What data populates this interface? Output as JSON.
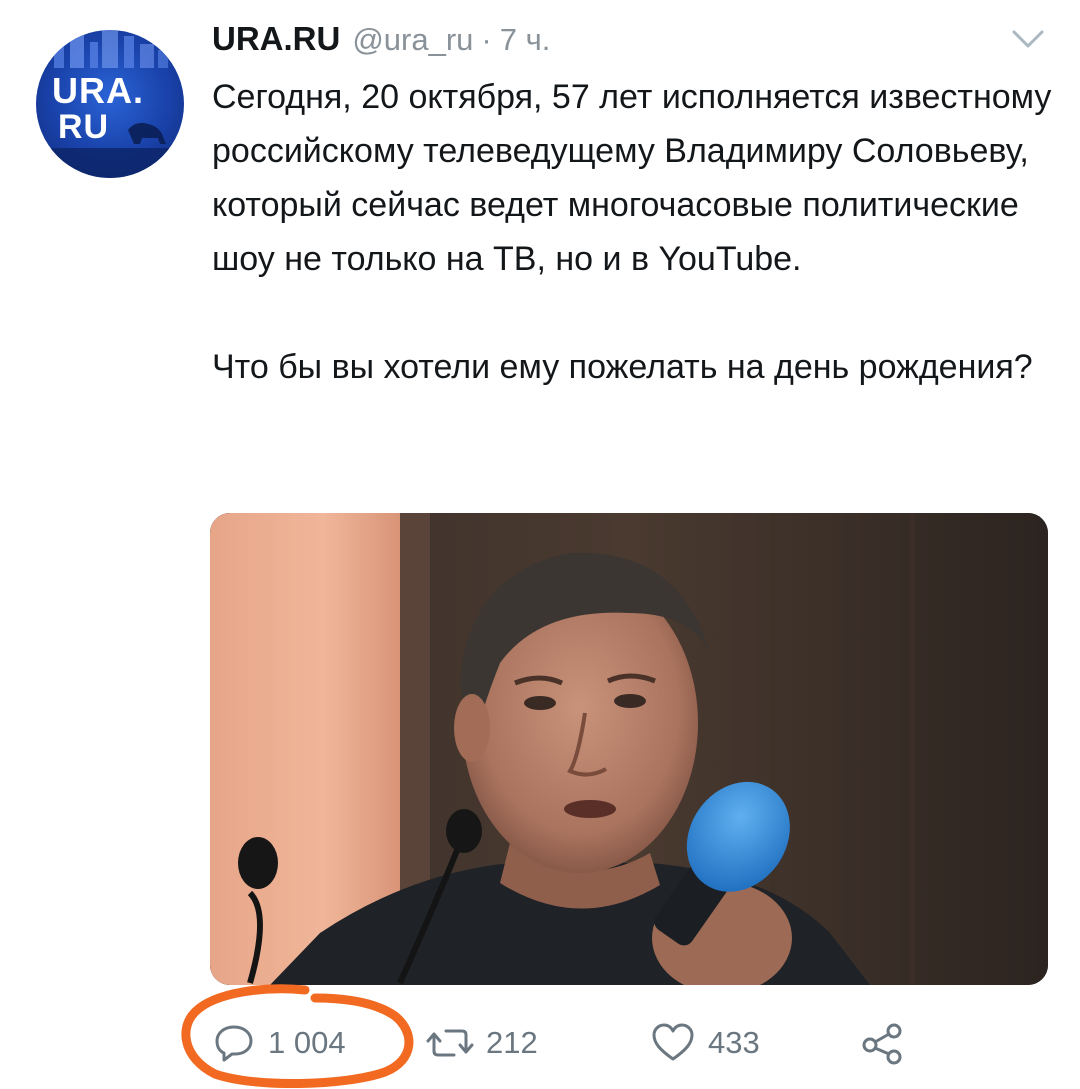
{
  "avatar": {
    "logo_line1": "URA.",
    "logo_line2": "RU",
    "icon": "ura-ru-logo"
  },
  "header": {
    "display_name": "URA.RU",
    "handle": "@ura_ru",
    "separator": "·",
    "time": "7 ч.",
    "menu_icon": "chevron-down-icon"
  },
  "tweet": {
    "paragraph1": "Сегодня, 20 октября, 57 лет исполняется известному российскому телеведущему Владимиру Соловьеву, который сейчас ведет многочасовые политические шоу не только на ТВ, но и в YouTube.",
    "paragraph2": "Что бы вы хотели ему пожелать на день рождения?"
  },
  "media": {
    "kind": "photo",
    "icon": "photo-of-man-speaking-into-blue-microphone"
  },
  "actions": {
    "reply": {
      "icon": "reply-icon",
      "count": "1 004"
    },
    "retweet": {
      "icon": "retweet-icon",
      "count": "212"
    },
    "like": {
      "icon": "heart-icon",
      "count": "433"
    },
    "share": {
      "icon": "share-icon"
    }
  },
  "colors": {
    "text": "#14171a",
    "muted": "#8a9299",
    "action_gray": "#6b7780",
    "annotation_orange": "#f26a21",
    "avatar_blue": "#1941a8"
  }
}
